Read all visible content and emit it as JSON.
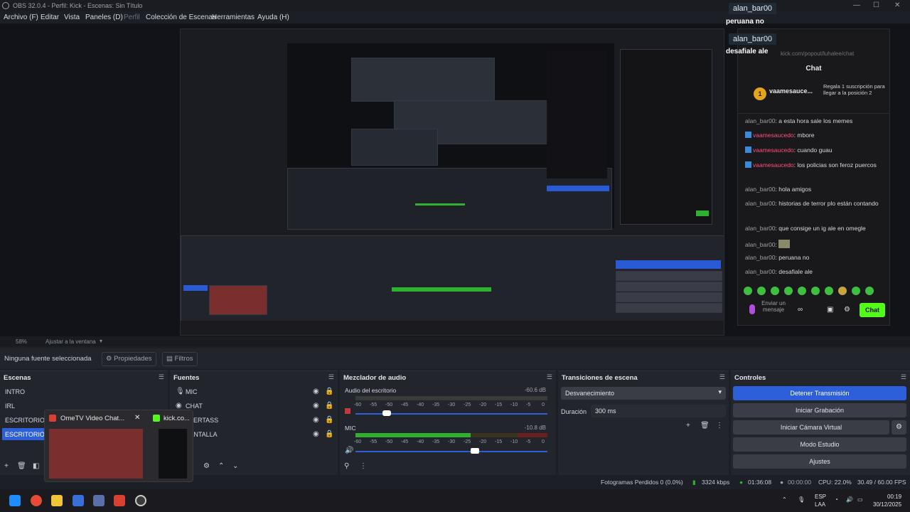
{
  "window": {
    "title": "OBS 32.0.4 - Perfil: Kick - Escenas: Sin Título"
  },
  "menu": [
    {
      "label": "Archivo (F)",
      "dim": false
    },
    {
      "label": "Editar",
      "dim": false
    },
    {
      "label": "Vista",
      "dim": false
    },
    {
      "label": "Paneles (D)",
      "dim": false
    },
    {
      "label": "Perfil",
      "dim": true
    },
    {
      "label": "Colección de Escenas",
      "dim": false
    },
    {
      "label": "Herramientas",
      "dim": false
    },
    {
      "label": "Ayuda (H)",
      "dim": false
    }
  ],
  "overlay": {
    "user1": "alan_bar00",
    "msg1": "peruana no",
    "user2": "alan_bar00",
    "msg2": "desafiale ale"
  },
  "chat": {
    "url": "kick.com/popout/luhalee/chat",
    "header": "Chat",
    "gift_user": "vaamesauce...",
    "gift_count": "1",
    "gift_text": "Regala 1 suscripción para llegar a la posición 2",
    "messages": [
      {
        "user": "alan_bar00",
        "text": "a esta hora sale los memes",
        "red": false,
        "badge": false
      },
      {
        "user": "vaamesaucedo",
        "text": "mbore",
        "red": true,
        "badge": true
      },
      {
        "user": "vaamesaucedo",
        "text": "cuando guau",
        "red": true,
        "badge": true
      },
      {
        "user": "vaamesaucedo",
        "text": "los policias son feroz puercos",
        "red": true,
        "badge": true
      },
      {
        "user": "alan_bar00",
        "text": "hola amigos",
        "red": false,
        "badge": false
      },
      {
        "user": "alan_bar00",
        "text": "historias de terror plo están contando",
        "red": false,
        "badge": false
      },
      {
        "user": "alan_bar00",
        "text": "que consige un ig ale en omegle",
        "red": false,
        "badge": false
      },
      {
        "user": "alan_bar00",
        "text": "",
        "red": false,
        "badge": false
      },
      {
        "user": "alan_bar00",
        "text": "peruana no",
        "red": false,
        "badge": false
      },
      {
        "user": "alan_bar00",
        "text": "desafiale ale",
        "red": false,
        "badge": false
      }
    ],
    "input_placeholder": "Enviar un mensaje",
    "send_label": "Chat",
    "accent": "#53fc18"
  },
  "zoom": {
    "value": "58%",
    "fit_label": "Ajustar a la ventana"
  },
  "sourcebar": {
    "none_selected": "Ninguna fuente seleccionada",
    "properties": "Propiedades",
    "filters": "Filtros"
  },
  "scenes": {
    "title": "Escenas",
    "items": [
      "INTRO",
      "IRL",
      "ESCRITORIO",
      "ESCRITORIO 5"
    ],
    "selected_index": 3
  },
  "sources": {
    "title": "Fuentes",
    "items": [
      {
        "label": "MIC",
        "icon": "mic-icon"
      },
      {
        "label": "CHAT",
        "icon": "browser-icon"
      },
      {
        "label": "ALERTASS",
        "icon": "browser-icon"
      },
      {
        "label": "PANTALLA",
        "icon": "monitor-icon"
      }
    ]
  },
  "mixer": {
    "title": "Mezclador de audio",
    "channels": [
      {
        "name": "Audio del escritorio",
        "db": "-60.6 dB",
        "level": 0.0
      },
      {
        "name": "MIC",
        "db": "-10.8 dB",
        "level": 0.6
      }
    ],
    "scale": [
      "-60",
      "-55",
      "-50",
      "-45",
      "-40",
      "-35",
      "-30",
      "-25",
      "-20",
      "-15",
      "-10",
      "-5",
      "0"
    ]
  },
  "transitions": {
    "title": "Transiciones de escena",
    "selected": "Desvanecimiento",
    "duration_label": "Duración",
    "duration_value": "300 ms"
  },
  "controls": {
    "title": "Controles",
    "buttons": [
      "Detener Transmisión",
      "Iniciar Grabación",
      "Iniciar Cámara Virtual",
      "Modo Estudio",
      "Ajustes"
    ]
  },
  "status": {
    "dropped": "Fotogramas Perdidos 0 (0.0%)",
    "bitrate": "3324 kbps",
    "stream_time": "01:36:08",
    "rec_time": "00:00:00",
    "cpu": "CPU: 22.0%",
    "fps": "30.49 / 60.00 FPS"
  },
  "taskbar": {
    "lang_top": "ESP",
    "lang_bottom": "LAA",
    "time": "00:19",
    "date": "30/12/2025"
  },
  "thumb_popup": {
    "title1": "OmeTV Video Chat...",
    "title2": "kick.co..."
  }
}
